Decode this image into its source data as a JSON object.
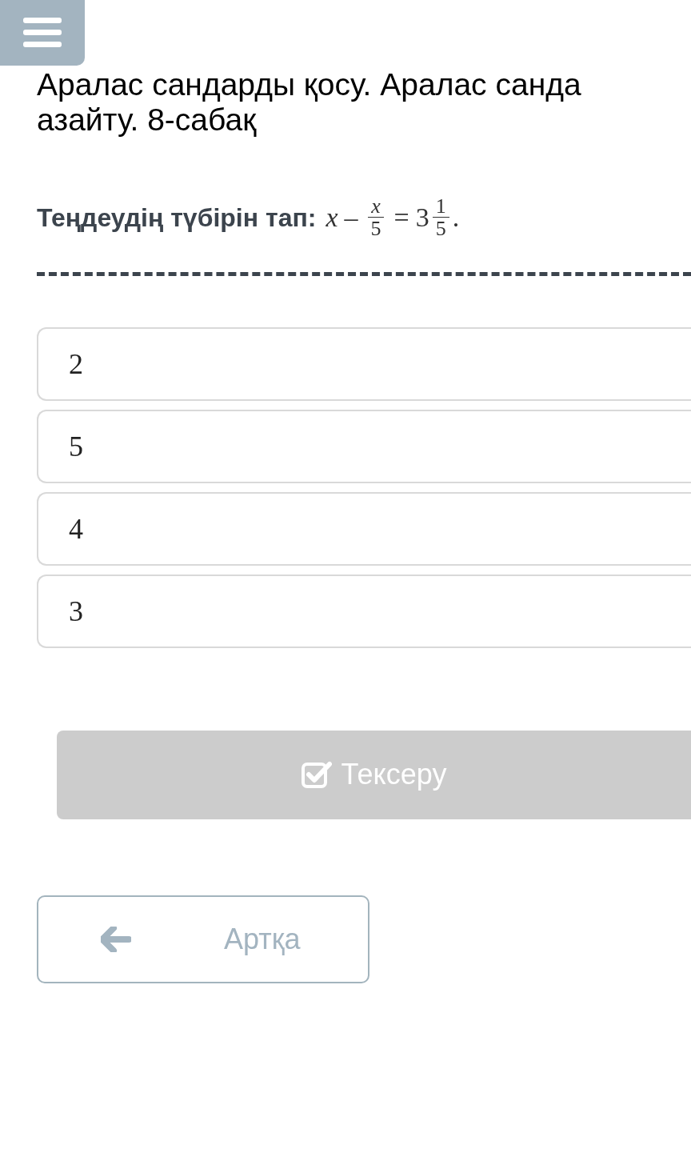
{
  "title_lines": [
    "Аралас сандарды қосу. Аралас санда",
    "азайту. 8-сабақ"
  ],
  "question": {
    "label": "Теңдеудің түбірін тап:",
    "equation": [
      {
        "kind": "var",
        "text": "x"
      },
      {
        "kind": "op",
        "text": "–"
      },
      {
        "kind": "frac",
        "num": "x",
        "den": "5"
      },
      {
        "kind": "op",
        "text": "="
      },
      {
        "kind": "num",
        "text": "3"
      },
      {
        "kind": "frac",
        "num": "1",
        "den": "5"
      },
      {
        "kind": "num",
        "text": "."
      }
    ]
  },
  "options": [
    {
      "text": "2",
      "selected": false
    },
    {
      "text": "5",
      "selected": false
    },
    {
      "text": "4",
      "selected": false
    },
    {
      "text": "3",
      "selected": false
    }
  ],
  "check_button": {
    "label": "Тексеру",
    "disabled": true
  },
  "back_button": {
    "label": "Артқа"
  }
}
